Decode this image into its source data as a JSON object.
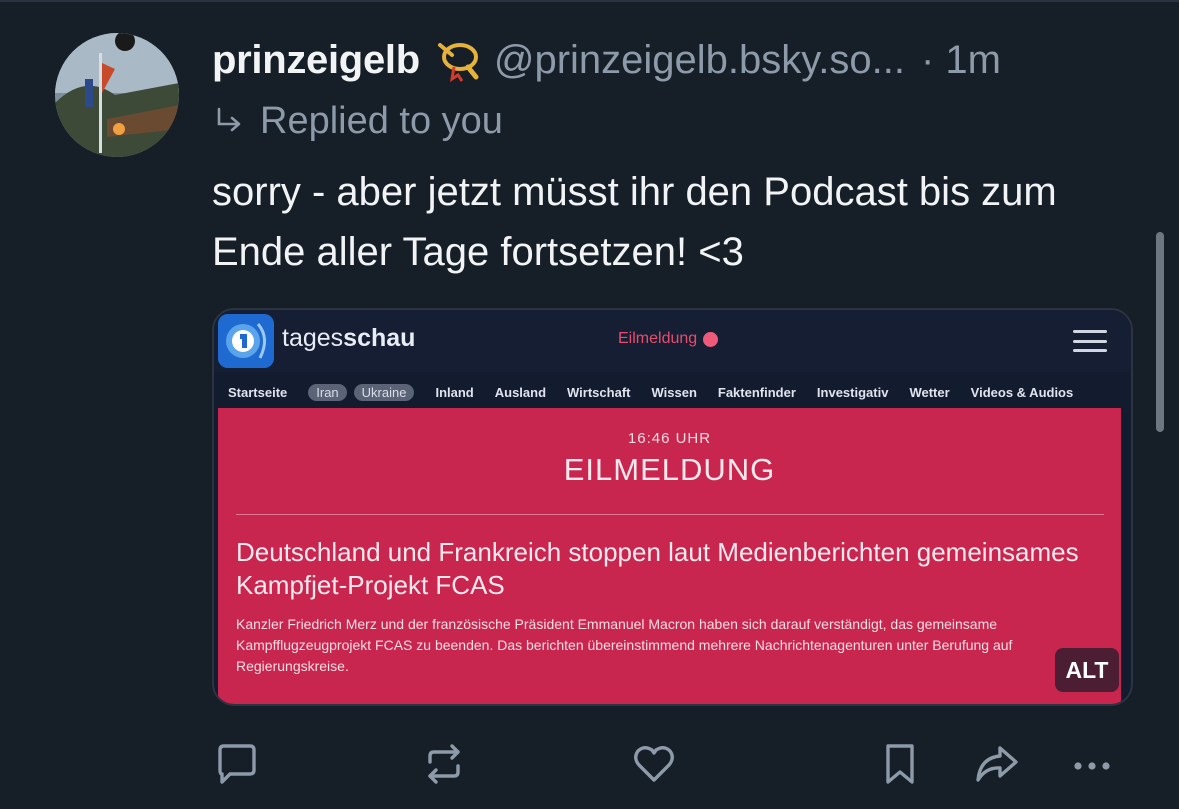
{
  "post": {
    "display_name": "prinzeigelb",
    "handle": "@prinzeigelb.bsky.so...",
    "time": "· 1m",
    "replied_to": "Replied to you",
    "text": "sorry - aber jetzt müsst ihr den Podcast bis zum Ende aller Tage fortsetzen! <3",
    "name_emoji": "postal-horn-icon"
  },
  "embed": {
    "brand_light": "tages",
    "brand_bold": "schau",
    "eilmeldung_label": "Eilmeldung",
    "nav": {
      "startseite": "Startseite",
      "iran": "Iran",
      "ukraine": "Ukraine",
      "inland": "Inland",
      "ausland": "Ausland",
      "wirtschaft": "Wirtschaft",
      "wissen": "Wissen",
      "faktenfinder": "Faktenfinder",
      "investigativ": "Investigativ",
      "wetter": "Wetter",
      "videos": "Videos & Audios"
    },
    "time": "16:46 UHR",
    "title": "EILMELDUNG",
    "headline": "Deutschland und Frankreich stoppen laut Medienberichten gemeinsames Kampfjet-Projekt FCAS",
    "body": "Kanzler Friedrich Merz und der französische Präsident Emmanuel Macron haben sich darauf verständigt, das gemeinsame Kampfflugzeugprojekt FCAS zu beenden. Das berichten übereinstimmend mehrere Nachrichtenagenturen unter Berufung auf Regierungskreise.",
    "alt_badge": "ALT"
  },
  "actions": [
    "reply-icon",
    "repost-icon",
    "like-icon",
    "bookmark-icon",
    "share-icon",
    "more-icon"
  ],
  "colors": {
    "background": "#161e27",
    "muted_text": "#8d9aa9",
    "alert_red": "#c8264e"
  }
}
